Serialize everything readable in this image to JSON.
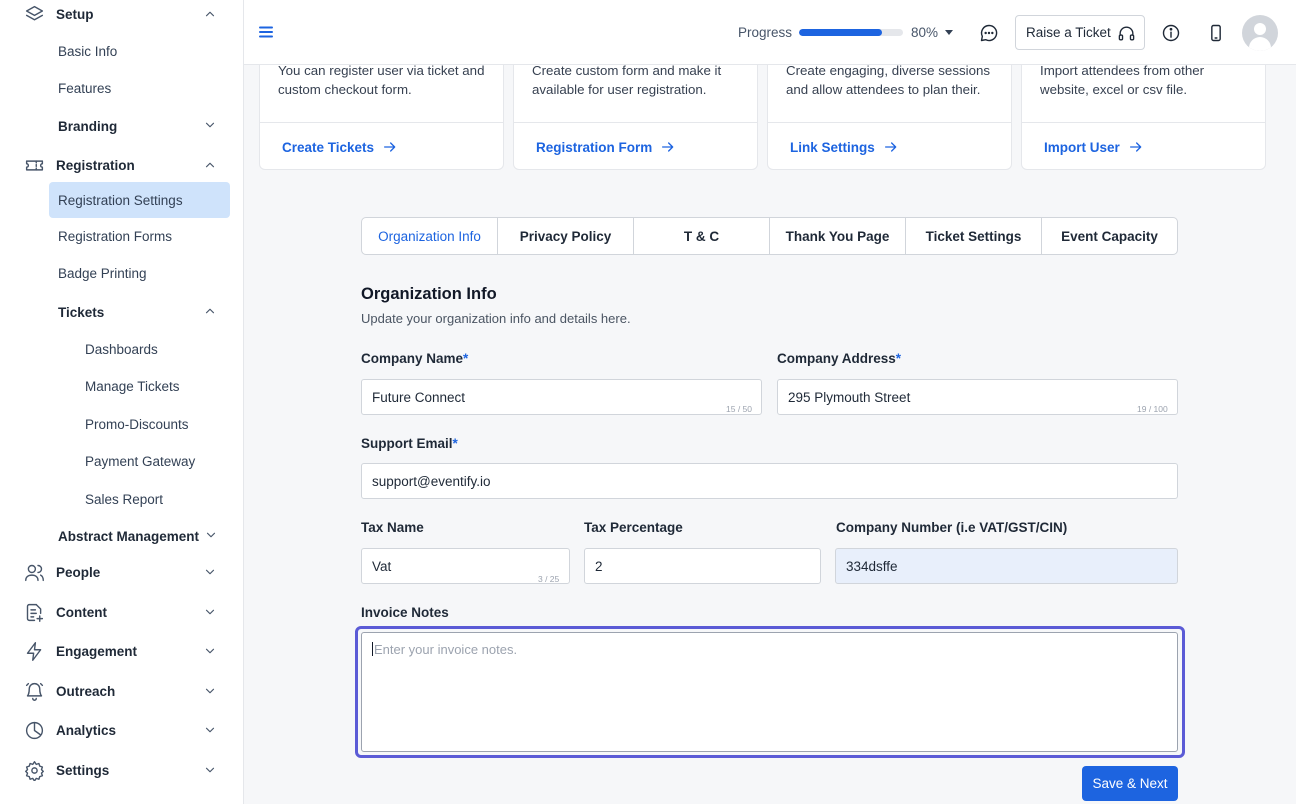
{
  "sidebar": {
    "setup": "Setup",
    "basic_info": "Basic Info",
    "features": "Features",
    "branding": "Branding",
    "registration": "Registration",
    "registration_settings": "Registration Settings",
    "registration_forms": "Registration Forms",
    "badge_printing": "Badge Printing",
    "tickets": "Tickets",
    "dashboards": "Dashboards",
    "manage_tickets": "Manage Tickets",
    "promo_discounts": "Promo-Discounts",
    "payment_gateway": "Payment Gateway",
    "sales_report": "Sales Report",
    "abstract_management": "Abstract Management",
    "people": "People",
    "content": "Content",
    "engagement": "Engagement",
    "outreach": "Outreach",
    "analytics": "Analytics",
    "settings": "Settings"
  },
  "topbar": {
    "progress_label": "Progress",
    "progress_value": 0.8,
    "progress_text": "80%",
    "raise_ticket": "Raise a Ticket"
  },
  "cards": [
    {
      "desc": "You can register user via ticket and custom checkout form.",
      "link": "Create Tickets"
    },
    {
      "desc": "Create custom form and make it available for user registration.",
      "link": "Registration Form"
    },
    {
      "desc": "Create engaging, diverse sessions and allow attendees to plan their.",
      "link": "Link Settings"
    },
    {
      "desc": "Import attendees from other website, excel or csv file.",
      "link": "Import User"
    }
  ],
  "tabs": [
    "Organization Info",
    "Privacy Policy",
    "T & C",
    "Thank You Page",
    "Ticket Settings",
    "Event Capacity"
  ],
  "form": {
    "title": "Organization Info",
    "subtitle": "Update your organization info and details here.",
    "company_name_label": "Company Name",
    "company_name": "Future Connect",
    "company_name_count": "15 / 50",
    "company_address_label": "Company Address",
    "company_address": "295 Plymouth Street",
    "company_address_count": "19 / 100",
    "support_email_label": "Support Email",
    "support_email": "support@eventify.io",
    "tax_name_label": "Tax Name",
    "tax_name": "Vat",
    "tax_name_count": "3 / 25",
    "tax_percentage_label": "Tax Percentage",
    "tax_percentage": "2",
    "company_number_label": "Company Number (i.e VAT/GST/CIN)",
    "company_number": "334dsffe",
    "invoice_notes_label": "Invoice Notes",
    "invoice_notes_placeholder": "Enter your invoice notes.",
    "required_mark": "*",
    "save_button": "Save & Next"
  }
}
